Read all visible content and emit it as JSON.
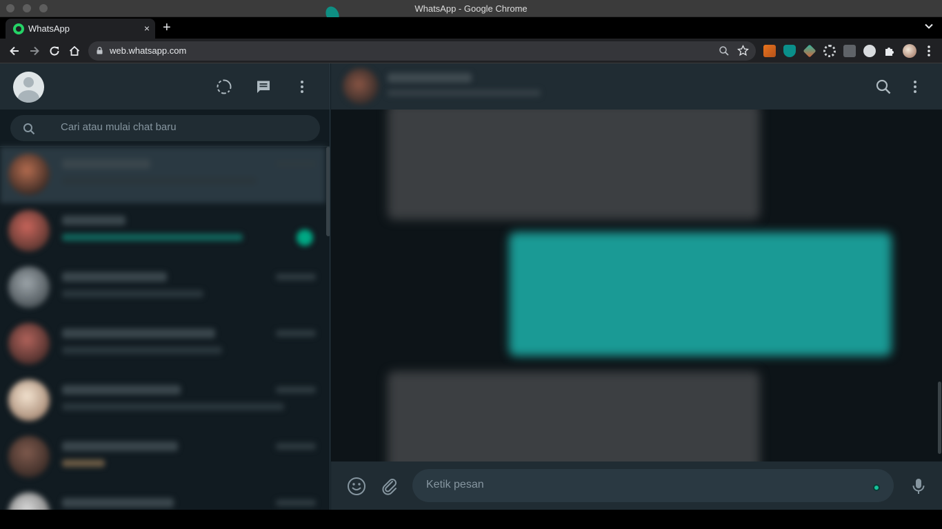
{
  "window": {
    "title": "WhatsApp - Google Chrome"
  },
  "browser": {
    "tab_label": "WhatsApp",
    "tab_close": "×",
    "new_tab": "+",
    "url": "web.whatsapp.com"
  },
  "sidebar": {
    "search_placeholder": "Cari atau mulai chat baru",
    "icons": [
      "status-icon",
      "new-chat-icon",
      "menu-icon"
    ]
  },
  "chat": {
    "composer_placeholder": "Ketik pesan",
    "header_icons": [
      "search-icon",
      "menu-icon"
    ]
  },
  "colors": {
    "panel": "#202c33",
    "background": "#111b21",
    "outgoing_bubble": "#1a9a95",
    "accent": "#00a884"
  }
}
